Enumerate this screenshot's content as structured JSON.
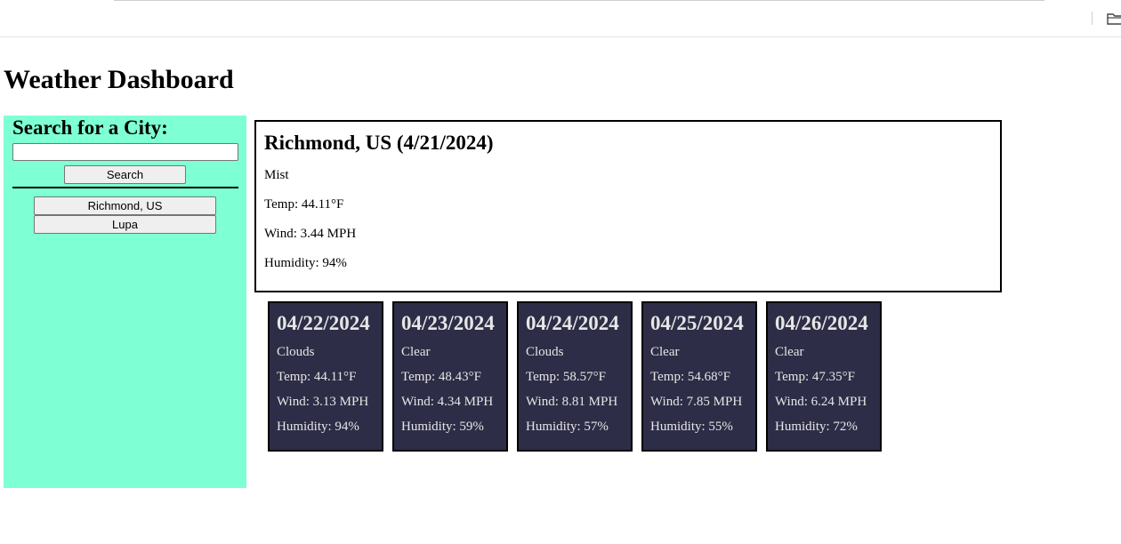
{
  "page": {
    "title": "Weather Dashboard"
  },
  "search": {
    "heading": "Search for a City:",
    "input_value": "",
    "button_label": "Search"
  },
  "history": [
    {
      "label": "Richmond, US"
    },
    {
      "label": "Lupa"
    }
  ],
  "current": {
    "heading": "Richmond, US (4/21/2024)",
    "condition": "Mist",
    "temp": "Temp: 44.11°F",
    "wind": "Wind: 3.44 MPH",
    "humidity": "Humidity: 94%"
  },
  "forecast": [
    {
      "date": "04/22/2024",
      "condition": "Clouds",
      "temp": "Temp: 44.11°F",
      "wind": "Wind: 3.13 MPH",
      "humidity": "Humidity: 94%"
    },
    {
      "date": "04/23/2024",
      "condition": "Clear",
      "temp": "Temp: 48.43°F",
      "wind": "Wind: 4.34 MPH",
      "humidity": "Humidity: 59%"
    },
    {
      "date": "04/24/2024",
      "condition": "Clouds",
      "temp": "Temp: 58.57°F",
      "wind": "Wind: 8.81 MPH",
      "humidity": "Humidity: 57%"
    },
    {
      "date": "04/25/2024",
      "condition": "Clear",
      "temp": "Temp: 54.68°F",
      "wind": "Wind: 7.85 MPH",
      "humidity": "Humidity: 55%"
    },
    {
      "date": "04/26/2024",
      "condition": "Clear",
      "temp": "Temp: 47.35°F",
      "wind": "Wind: 6.24 MPH",
      "humidity": "Humidity: 72%"
    }
  ],
  "toolbar": {
    "folder_icon": "folder-icon"
  },
  "colors": {
    "sidebar_bg": "#7fffd4",
    "card_bg": "#2e2d47",
    "card_text": "#e6e6e6"
  }
}
